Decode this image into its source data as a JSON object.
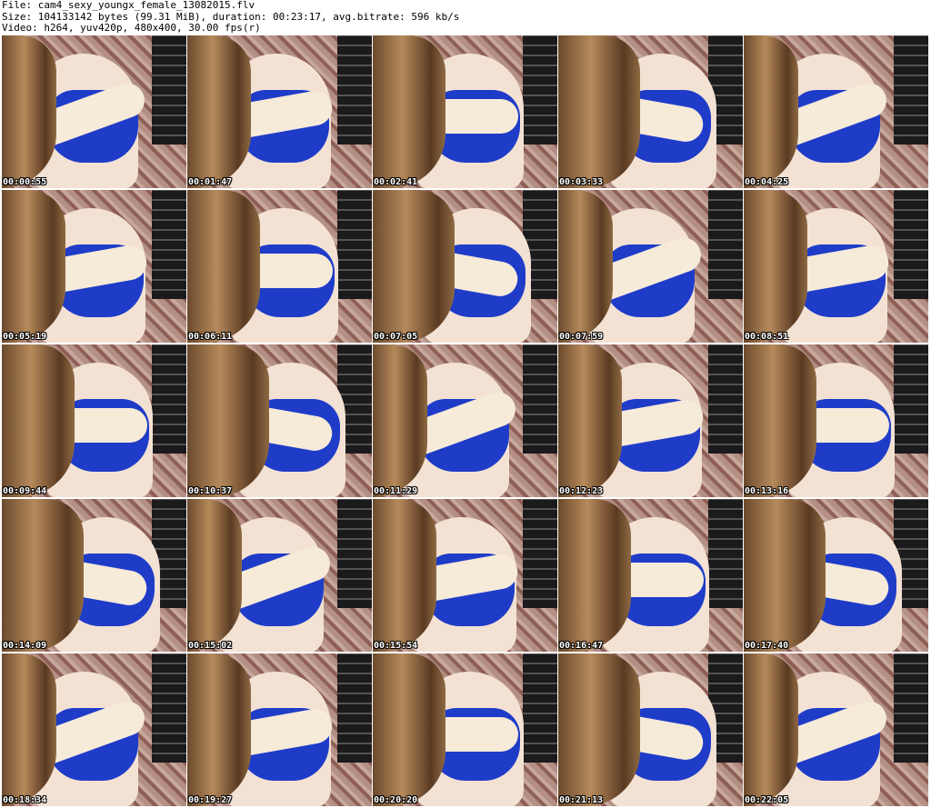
{
  "header": {
    "file_line": "File: cam4_sexy_youngx_female_13082015.flv",
    "size_line": "Size: 104133142 bytes (99.31 MiB), duration: 00:23:17, avg.bitrate: 596 kb/s",
    "video_line": "Video: h264, yuv420p, 480x400, 30.00 fps(r)"
  },
  "thumbnails": [
    {
      "timestamp": "00:00:55"
    },
    {
      "timestamp": "00:01:47"
    },
    {
      "timestamp": "00:02:41"
    },
    {
      "timestamp": "00:03:33"
    },
    {
      "timestamp": "00:04:25"
    },
    {
      "timestamp": "00:05:19"
    },
    {
      "timestamp": "00:06:11"
    },
    {
      "timestamp": "00:07:05"
    },
    {
      "timestamp": "00:07:59"
    },
    {
      "timestamp": "00:08:51"
    },
    {
      "timestamp": "00:09:44"
    },
    {
      "timestamp": "00:10:37"
    },
    {
      "timestamp": "00:11:29"
    },
    {
      "timestamp": "00:12:23"
    },
    {
      "timestamp": "00:13:16"
    },
    {
      "timestamp": "00:14:09"
    },
    {
      "timestamp": "00:15:02"
    },
    {
      "timestamp": "00:15:54"
    },
    {
      "timestamp": "00:16:47"
    },
    {
      "timestamp": "00:17:40"
    },
    {
      "timestamp": "00:18:34"
    },
    {
      "timestamp": "00:19:27"
    },
    {
      "timestamp": "00:20:20"
    },
    {
      "timestamp": "00:21:13"
    },
    {
      "timestamp": "00:22:05"
    }
  ]
}
